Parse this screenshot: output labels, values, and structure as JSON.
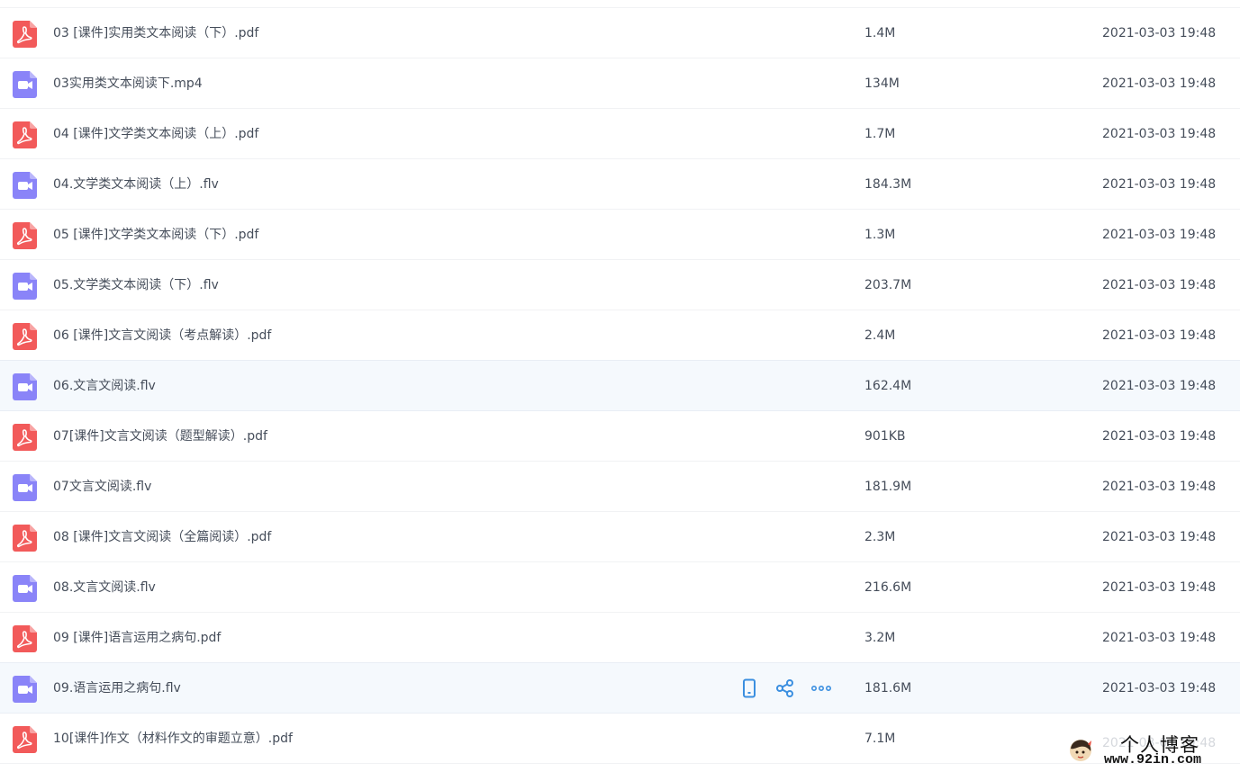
{
  "colors": {
    "pdf_icon": "#f25a5a",
    "video_icon": "#8a84f8",
    "action_icon": "#3b8fe0",
    "text": "#454d5a",
    "row_hover_bg": "#f5f9fd",
    "divider": "#f1f2f4"
  },
  "file_list": {
    "rows": [
      {
        "name": "03 [课件]实用类文本阅读（下）.pdf",
        "size": "1.4M",
        "time": "2021-03-03 19:48",
        "icon": "pdf-icon"
      },
      {
        "name": "03实用类文本阅读下.mp4",
        "size": "134M",
        "time": "2021-03-03 19:48",
        "icon": "video-icon"
      },
      {
        "name": "04 [课件]文学类文本阅读（上）.pdf",
        "size": "1.7M",
        "time": "2021-03-03 19:48",
        "icon": "pdf-icon"
      },
      {
        "name": "04.文学类文本阅读（上）.flv",
        "size": "184.3M",
        "time": "2021-03-03 19:48",
        "icon": "video-icon"
      },
      {
        "name": "05 [课件]文学类文本阅读（下）.pdf",
        "size": "1.3M",
        "time": "2021-03-03 19:48",
        "icon": "pdf-icon"
      },
      {
        "name": "05.文学类文本阅读（下）.flv",
        "size": "203.7M",
        "time": "2021-03-03 19:48",
        "icon": "video-icon"
      },
      {
        "name": "06 [课件]文言文阅读（考点解读）.pdf",
        "size": "2.4M",
        "time": "2021-03-03 19:48",
        "icon": "pdf-icon"
      },
      {
        "name": "06.文言文阅读.flv",
        "size": "162.4M",
        "time": "2021-03-03 19:48",
        "icon": "video-icon"
      },
      {
        "name": "07[课件]文言文阅读（题型解读）.pdf",
        "size": "901KB",
        "time": "2021-03-03 19:48",
        "icon": "pdf-icon"
      },
      {
        "name": "07文言文阅读.flv",
        "size": "181.9M",
        "time": "2021-03-03 19:48",
        "icon": "video-icon"
      },
      {
        "name": "08 [课件]文言文阅读（全篇阅读）.pdf",
        "size": "2.3M",
        "time": "2021-03-03 19:48",
        "icon": "pdf-icon"
      },
      {
        "name": "08.文言文阅读.flv",
        "size": "216.6M",
        "time": "2021-03-03 19:48",
        "icon": "video-icon"
      },
      {
        "name": "09 [课件]语言运用之病句.pdf",
        "size": "3.2M",
        "time": "2021-03-03 19:48",
        "icon": "pdf-icon"
      },
      {
        "name": "09.语言运用之病句.flv",
        "size": "181.6M",
        "time": "2021-03-03 19:48",
        "icon": "video-icon"
      },
      {
        "name": "10[课件]作文（材料作文的审题立意）.pdf",
        "size": "7.1M",
        "time": "",
        "icon": "pdf-icon"
      }
    ],
    "hover_actions": [
      "phone-icon",
      "share-icon",
      "more-icon"
    ]
  },
  "watermark": {
    "title": "个人博客",
    "url": "www.92in.com",
    "faded_time": "2021-03-03 19:48"
  }
}
